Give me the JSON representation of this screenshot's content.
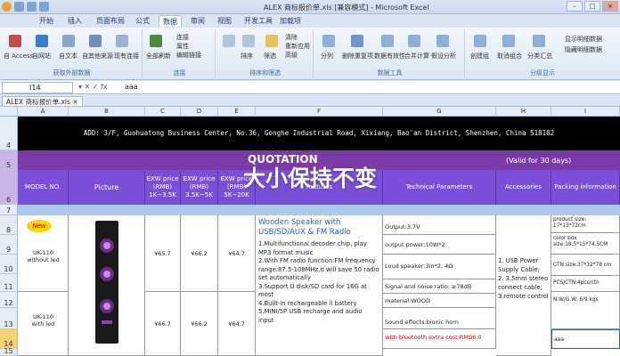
{
  "window": {
    "title": "ALEX 商标报价单.xls  [兼容模式] - Microsoft Excel",
    "controls": [
      "–",
      "□",
      "×"
    ]
  },
  "tabs": [
    "开始",
    "插入",
    "页面布局",
    "公式",
    "数据",
    "审阅",
    "视图",
    "开发工具",
    "加载项"
  ],
  "active_tab": "数据",
  "ribbon": {
    "groups": [
      {
        "label": "获取外部数据",
        "items": [
          "自 Access",
          "自网站",
          "自文本",
          "自其他来源",
          "现有连接"
        ]
      },
      {
        "label": "连接",
        "items": [
          "全部刷新",
          "连接",
          "属性",
          "编辑链接"
        ]
      },
      {
        "label": "排序和筛选",
        "items": [
          "排序",
          "筛选",
          "清除",
          "重新应用",
          "高级"
        ]
      },
      {
        "label": "数据工具",
        "items": [
          "分列",
          "删除重复项",
          "数据有效性",
          "合并计算",
          "假设分析"
        ]
      },
      {
        "label": "分级显示",
        "items": [
          "创建组",
          "取消组合",
          "分类汇总",
          "显示明细数据",
          "隐藏明细数据"
        ]
      }
    ]
  },
  "formula_bar": {
    "name_box": "I14",
    "fx_icons": "▾ ✕ ✓ fx",
    "value": "aaa"
  },
  "doc_tab": "ALEX 商标报价单.xls ×",
  "columns": [
    "A",
    "B",
    "C",
    "D",
    "E",
    "F",
    "G",
    "H",
    "I"
  ],
  "rows": [
    "4",
    "5",
    "6",
    "7",
    "8",
    "9",
    "10",
    "11",
    "12",
    "13",
    "14",
    "15"
  ],
  "sheet": {
    "address": "ADD: 3/F, Guohuatong Business Center, No.36, Gonghe Industrial Road, Xixiang, Bao'an District, Shenzhen, China 518102",
    "quotation_label": "QUOTATION",
    "valid": "(Valid for 30 days)",
    "headers": {
      "model": "MODEL NO.",
      "picture": "Picture",
      "exw1": "EXW price (RMB)",
      "exw1_sub": "1K~3.5K",
      "exw2": "EXW price (RMB)",
      "exw2_sub": "3.5K~5K",
      "exw3": "EXW price (RMB)",
      "exw3_sub": "5K~20K",
      "features": "Features",
      "tech": "Technical Parameters",
      "accessories": "Accessories",
      "packing": "Packing information"
    },
    "products": [
      {
        "badge": "New",
        "model": "UK-110\nwithout led",
        "p1": "¥65.7",
        "p2": "¥66.2",
        "p3": "¥64.7"
      },
      {
        "model": "UK-110\nwith led",
        "p1": "¥66.7",
        "p2": "¥66.2",
        "p3": "¥64.7"
      }
    ],
    "features_title": "Wooden Speaker with USB/SD/AUX & FM Radio",
    "features_lines": [
      "1.Multifunctional decoder chip, play MP3 format music",
      "2.With FM radio function:FM frequency range:87.5-108MHz,it will save 50 radio set automatically",
      "3.Support U disk/SD card for 16G at most",
      "4.Built-in rechargeable li battery",
      "5.MINI/5P USB recharge and audio input"
    ],
    "tech_lines": [
      "Output:3.7V",
      "output power:10W*2",
      "Loud speaker:3in*2, 4Ω",
      "Signal and noise ratio: ≥78dB",
      "material:WOOD",
      "Sound effects:bionic horn",
      "with bluetooth extra cost RMB6.0"
    ],
    "accessories_lines": [
      "1. USB Power Supply Cable;",
      "2. 3.5mm stereo connect cable;",
      "3.remote control"
    ],
    "packing_lines": [
      "product size: 17*13*72cm",
      "color box size:18.5*15*74.5CM",
      "CTN size:37*32*78 cm",
      "PCS/CTN:4pcs/ctn",
      "N.W/G.W:  6/9 kgs",
      "aaa"
    ]
  },
  "overlay_text": "大小保持不变",
  "colors": {
    "header_purple": "#7a4fd8",
    "quotation_purple": "#7c3aa6",
    "light_blue": "#a9c9ec",
    "red_text": "#d40000"
  }
}
